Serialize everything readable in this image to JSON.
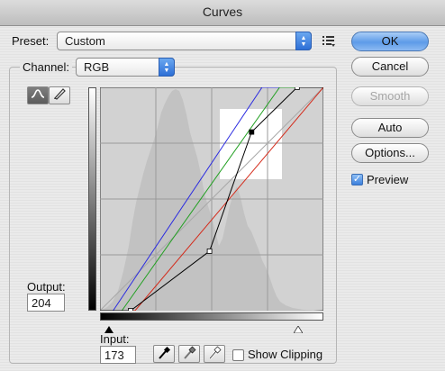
{
  "window": {
    "title": "Curves"
  },
  "preset": {
    "label": "Preset:",
    "value": "Custom"
  },
  "channel": {
    "label": "Channel:",
    "value": "RGB"
  },
  "buttons": {
    "ok": "OK",
    "cancel": "Cancel",
    "smooth": "Smooth",
    "auto": "Auto",
    "options": "Options..."
  },
  "preview": {
    "label": "Preview",
    "checked": true
  },
  "output": {
    "label": "Output:",
    "value": "204"
  },
  "input": {
    "label": "Input:",
    "value": "173"
  },
  "show_clipping": {
    "label": "Show Clipping",
    "checked": false
  },
  "icons": {
    "preset_menu": "preset-options-icon",
    "curve_tool": "curve-point-tool-icon",
    "pencil_tool": "pencil-tool-icon",
    "black_eyedropper": "black-point-eyedropper-icon",
    "gray_eyedropper": "gray-point-eyedropper-icon",
    "white_eyedropper": "white-point-eyedropper-icon"
  },
  "colors": {
    "accent": "#4a8ae6",
    "curve_rgb": "#000000",
    "curve_red": "#d42a1a",
    "curve_green": "#22a022",
    "curve_blue": "#2a2ae0",
    "histogram": "#c4c4c4",
    "selected_region": "#ffffff"
  },
  "curves": {
    "rgb": [
      [
        0,
        0
      ],
      [
        35,
        0
      ],
      [
        125,
        68
      ],
      [
        173,
        204
      ],
      [
        225,
        255
      ],
      [
        255,
        255
      ]
    ],
    "red": [
      [
        0,
        0
      ],
      [
        40,
        0
      ],
      [
        255,
        255
      ]
    ],
    "green": [
      [
        0,
        0
      ],
      [
        25,
        0
      ],
      [
        205,
        255
      ],
      [
        255,
        255
      ]
    ],
    "blue": [
      [
        0,
        0
      ],
      [
        15,
        0
      ],
      [
        185,
        255
      ],
      [
        255,
        255
      ]
    ],
    "control_points": [
      [
        35,
        0
      ],
      [
        125,
        68
      ],
      [
        173,
        204
      ],
      [
        225,
        255
      ]
    ],
    "selected_point": [
      173,
      204
    ]
  }
}
